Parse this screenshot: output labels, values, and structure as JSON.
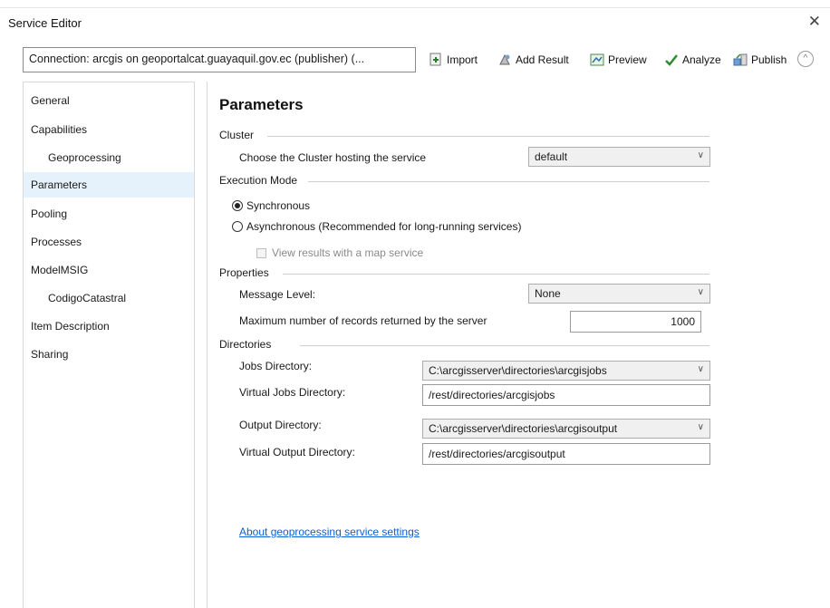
{
  "window": {
    "title": "Service Editor",
    "close_glyph": "✕"
  },
  "toolbar": {
    "connection": "Connection: arcgis on geoportalcat.guayaquil.gov.ec (publisher) (...",
    "buttons": [
      {
        "label": "Import",
        "icon": "import-icon"
      },
      {
        "label": "Add Result",
        "icon": "add-result-icon"
      },
      {
        "label": "Preview",
        "icon": "preview-icon"
      },
      {
        "label": "Analyze",
        "icon": "checkmark-icon"
      },
      {
        "label": "Publish",
        "icon": "publish-icon"
      }
    ],
    "collapse_glyph": "^"
  },
  "sidebar": {
    "items": [
      {
        "label": "General",
        "sub": false,
        "active": false
      },
      {
        "label": "Capabilities",
        "sub": false,
        "active": false
      },
      {
        "label": "Geoprocessing",
        "sub": true,
        "active": false
      },
      {
        "label": "Parameters",
        "sub": false,
        "active": true
      },
      {
        "label": "Pooling",
        "sub": false,
        "active": false
      },
      {
        "label": "Processes",
        "sub": false,
        "active": false
      },
      {
        "label": "ModelMSIG",
        "sub": false,
        "active": false
      },
      {
        "label": "CodigoCatastral",
        "sub": true,
        "active": false
      },
      {
        "label": "Item Description",
        "sub": false,
        "active": false
      },
      {
        "label": "Sharing",
        "sub": false,
        "active": false
      }
    ]
  },
  "main": {
    "title": "Parameters",
    "cluster": {
      "section": "Cluster",
      "label": "Choose the Cluster hosting the service",
      "value": "default"
    },
    "execution": {
      "section": "Execution Mode",
      "synchronous": "Synchronous",
      "asynchronous": "Asynchronous (Recommended for long-running services)",
      "map_service": "View results with a map service",
      "selected": "synchronous"
    },
    "properties": {
      "section": "Properties",
      "message_label": "Message Level:",
      "message_value": "None",
      "max_records_label": "Maximum number of records returned by the server",
      "max_records_value": "1000"
    },
    "directories": {
      "section": "Directories",
      "jobs_label": "Jobs Directory:",
      "jobs_value": "C:\\arcgisserver\\directories\\arcgisjobs",
      "virtual_jobs_label": "Virtual Jobs Directory:",
      "virtual_jobs_value": "/rest/directories/arcgisjobs",
      "output_label": "Output Directory:",
      "output_value": "C:\\arcgisserver\\directories\\arcgisoutput",
      "virtual_output_label": "Virtual Output Directory:",
      "virtual_output_value": "/rest/directories/arcgisoutput"
    },
    "about_link": "About geoprocessing service settings"
  },
  "colors": {
    "link": "#0b5fd6",
    "selected_item_bg": "#e5f1fb",
    "analyze_check": "#2e8b2e"
  }
}
